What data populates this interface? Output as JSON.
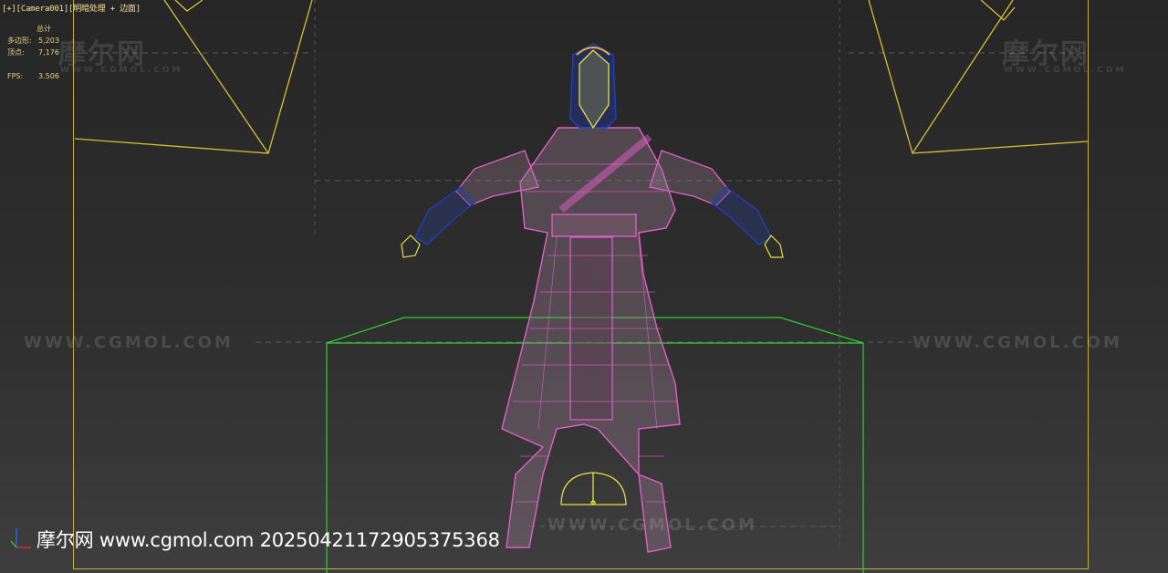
{
  "viewport": {
    "label_plus": "[+]",
    "label_camera": "[Camera001]",
    "label_mode": "[明暗处理 + 边面]"
  },
  "stats": {
    "header": "总计",
    "polys_label": "多边形:",
    "polys_value": "5,203",
    "verts_label": "顶点:",
    "verts_value": "7,176",
    "fps_label": "FPS:",
    "fps_value": "3.506"
  },
  "watermarks": {
    "brand_cn": "摩尔网",
    "brand_en": "WWW.CGMOL.COM",
    "url": "WWW.CGMOL.COM"
  },
  "footer": {
    "text": "摩尔网 www.cgmol.com 20250421172905375368"
  },
  "colors": {
    "frame": "#c8b040",
    "camera_lines": "#d8c030",
    "box": "#30d030",
    "mesh_cloth": "#e060c8",
    "mesh_hair": "#2040c0",
    "mesh_skin": "#e8e040"
  }
}
